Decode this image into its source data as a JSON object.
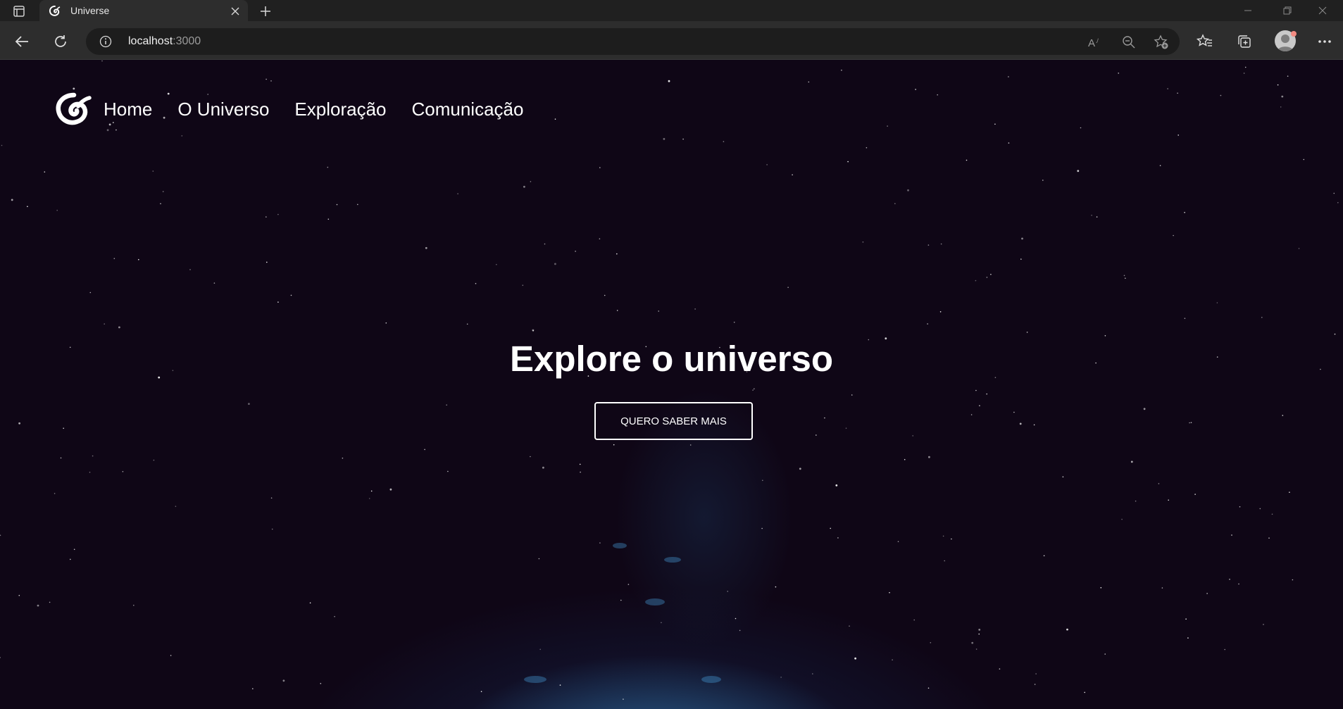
{
  "browser": {
    "tab": {
      "title": "Universe",
      "close_icon": "close-icon",
      "favicon": "swirl-logo-icon"
    },
    "new_tab_icon": "plus-icon",
    "address": {
      "host": "localhost",
      "port": ":3000",
      "info_icon": "info-icon"
    },
    "toolbar_icons": [
      "back-arrow-icon",
      "refresh-icon",
      "read-aloud-icon",
      "zoom-out-icon",
      "add-favorite-icon",
      "favorites-icon",
      "collections-icon",
      "profile-avatar",
      "more-icon"
    ],
    "window_controls": [
      "minimize-icon",
      "restore-icon",
      "close-window-icon"
    ]
  },
  "page": {
    "nav": {
      "logo": "swirl-logo-icon",
      "items": [
        {
          "label": "Home"
        },
        {
          "label": "O Universo"
        },
        {
          "label": "Exploração"
        },
        {
          "label": "Comunicação"
        }
      ]
    },
    "hero": {
      "title": "Explore o universo",
      "button_label": "QUERO SABER MAIS"
    }
  },
  "colors": {
    "background": "#0f0616",
    "nebula": "#3c96d2",
    "text": "#ffffff",
    "chrome_dark": "#202020",
    "chrome_toolbar": "#2d2d2d"
  }
}
